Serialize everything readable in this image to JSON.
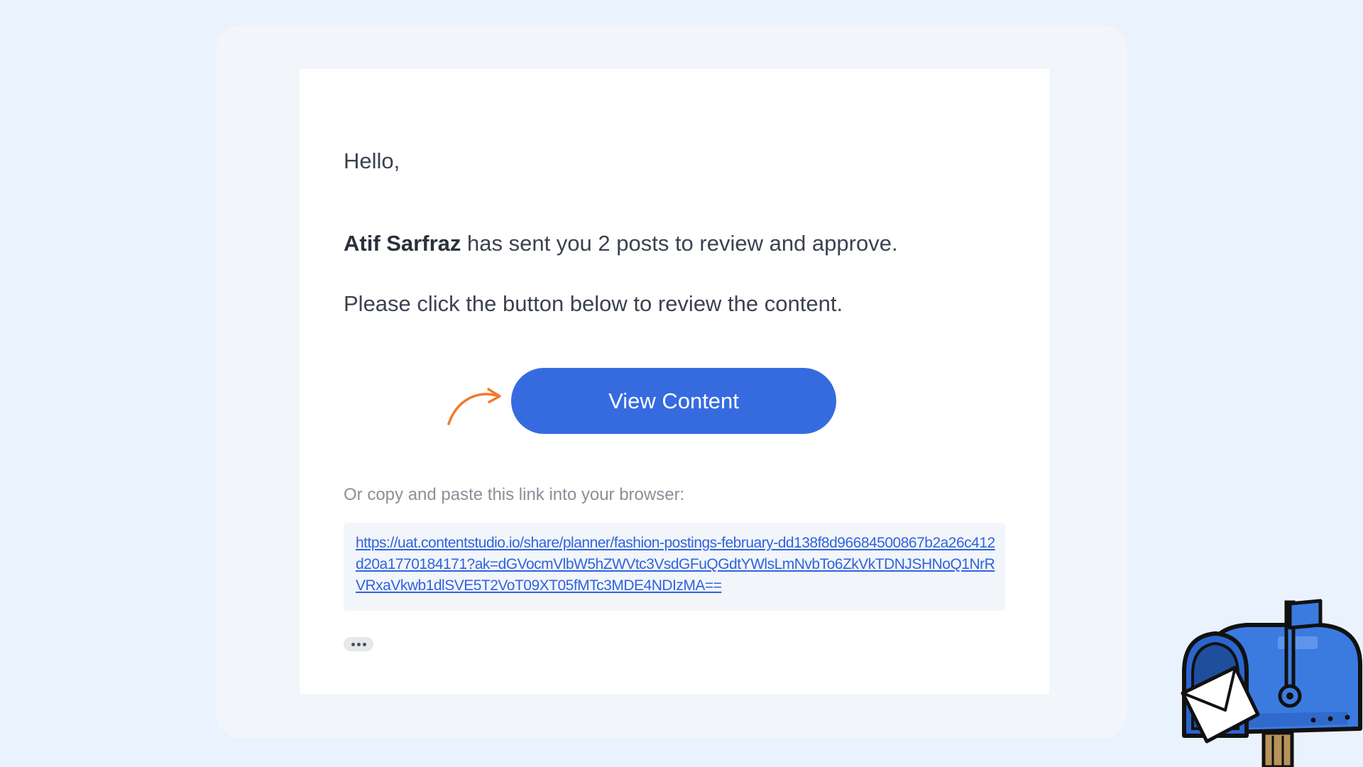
{
  "email": {
    "greeting": "Hello,",
    "sender_name": "Atif Sarfraz",
    "message_rest": " has sent you 2 posts to review and approve.",
    "instruction": "Please click the button below to review the content.",
    "button_label": "View Content",
    "copy_hint": "Or copy and paste this link into your browser:",
    "link": "https://uat.contentstudio.io/share/planner/fashion-postings-february-dd138f8d96684500867b2a26c412d20a1770184171?ak=dGVocmVlbW5hZWVtc3VsdGFuQGdtYWlsLmNvbTo6ZkVkTDNJSHNoQ1NrRVRxaVkwb1dlSVE5T2VoT09XT05fMTc3MDE4NDIzMA=="
  },
  "colors": {
    "page_background": "#eaf2fd",
    "button": "#366be0",
    "link": "#2f63e0",
    "arrow": "#f07a2c"
  },
  "icons": {
    "arrow": "curved-arrow-icon",
    "mailbox": "mailbox-icon",
    "more": "ellipsis-icon"
  }
}
